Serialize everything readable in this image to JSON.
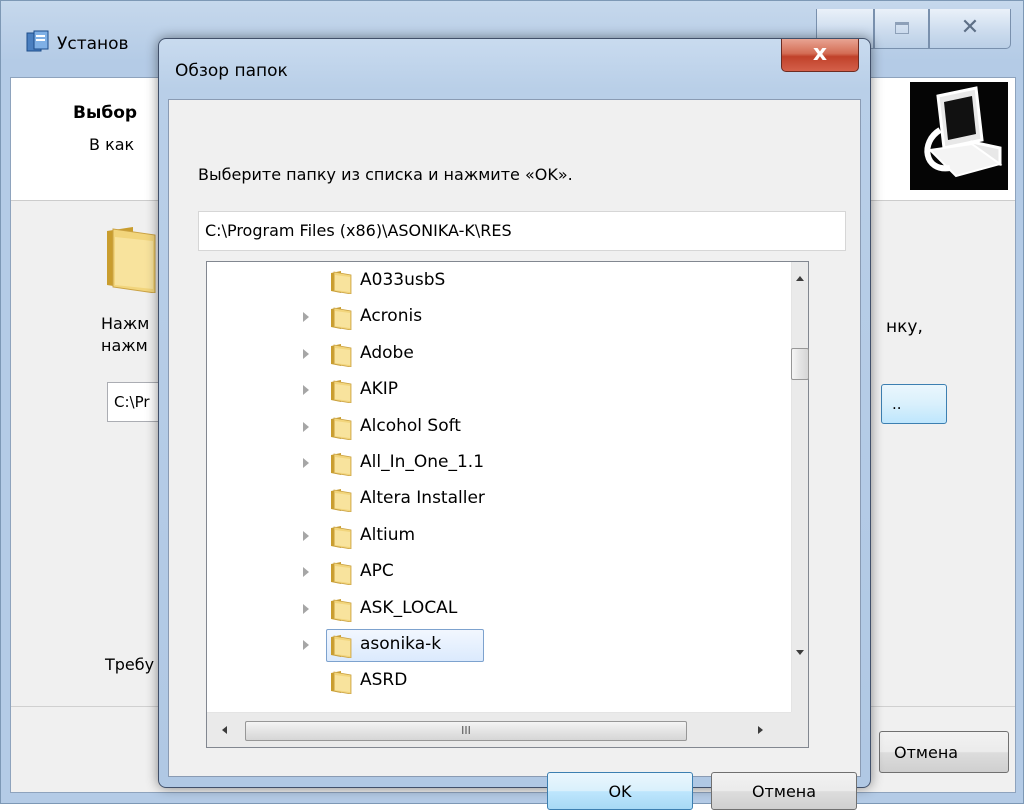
{
  "installer": {
    "title": "Установ",
    "header_title": "Выбор",
    "header_subtitle": "В как",
    "instruction_line1": "Нажм",
    "instruction_line2": "нажм",
    "instruction_right": "нку,",
    "path_value": "C:\\Pr",
    "browse_label": "..",
    "required_label": "Требу",
    "cancel_label": "Отмена"
  },
  "dialog": {
    "title": "Обзор папок",
    "close_glyph": "x",
    "instruction": "Выберите папку из списка и нажмите «OK».",
    "selected_path": "C:\\Program Files (x86)\\ASONIKA-K\\RES",
    "tree_items": [
      {
        "label": "A033usbS",
        "expandable": false,
        "selected": false
      },
      {
        "label": "Acronis",
        "expandable": true,
        "selected": false
      },
      {
        "label": "Adobe",
        "expandable": true,
        "selected": false
      },
      {
        "label": "AKIP",
        "expandable": true,
        "selected": false
      },
      {
        "label": "Alcohol Soft",
        "expandable": true,
        "selected": false
      },
      {
        "label": "All_In_One_1.1",
        "expandable": true,
        "selected": false
      },
      {
        "label": "Altera Installer",
        "expandable": false,
        "selected": false
      },
      {
        "label": "Altium",
        "expandable": true,
        "selected": false
      },
      {
        "label": "APC",
        "expandable": true,
        "selected": false
      },
      {
        "label": "ASK_LOCAL",
        "expandable": true,
        "selected": false
      },
      {
        "label": "asonika-k",
        "expandable": true,
        "selected": true
      },
      {
        "label": "ASRD",
        "expandable": false,
        "selected": false
      }
    ],
    "hscroll_grip": "III",
    "ok_label": "OK",
    "cancel_label": "Отмена"
  },
  "colors": {
    "folder_yellow": "#e8c65a",
    "selection_border": "#7da2ce",
    "close_red": "#c0412a"
  },
  "icons": {
    "folder": "folder-icon",
    "expand": "expand-arrow-icon",
    "close": "close-icon"
  }
}
